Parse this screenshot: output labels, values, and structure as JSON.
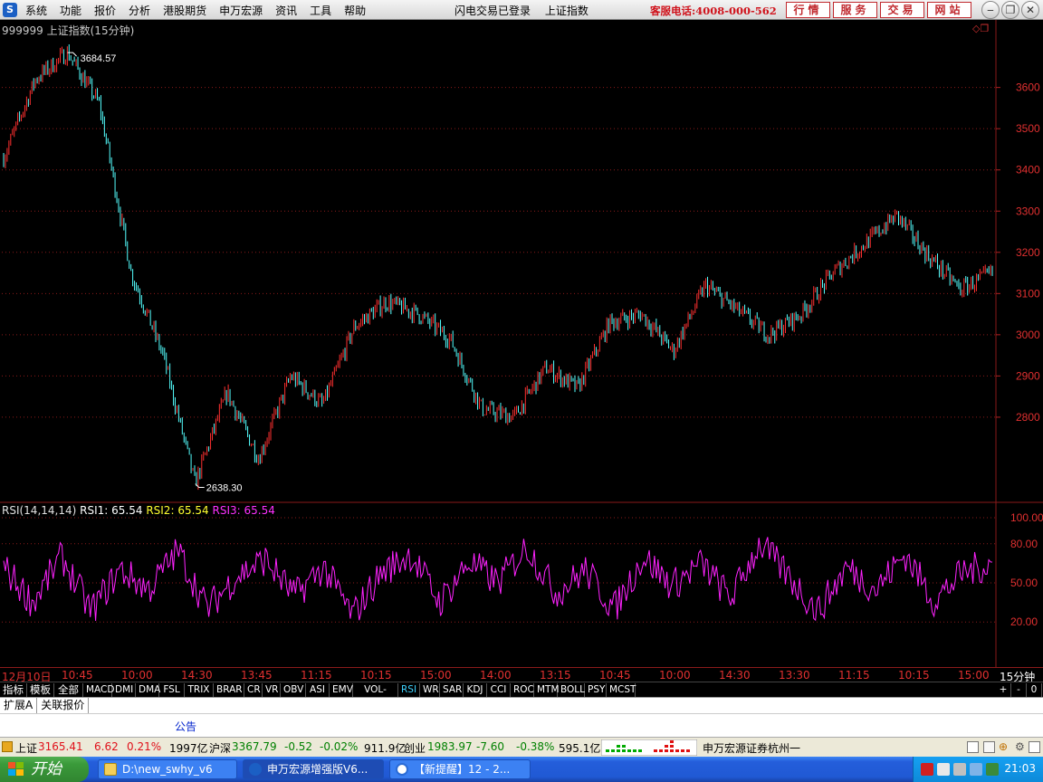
{
  "menubar": {
    "logo": "S",
    "items": [
      "系统",
      "功能",
      "报价",
      "分析",
      "港股期货",
      "申万宏源",
      "资讯",
      "工具",
      "帮助"
    ],
    "status_login": "闪电交易已登录",
    "current_index": "上证指数",
    "hotline": "客服电话:4008-000-562",
    "red_buttons": [
      "行情",
      "服务",
      "交易",
      "网站"
    ],
    "window_buttons": [
      "minimize-icon",
      "restore-icon",
      "close-icon"
    ]
  },
  "chart_header": {
    "code_name": "999999 上证指数(15分钟)",
    "high_label": "3684.57",
    "low_label": "2638.30"
  },
  "indicator_header": {
    "name": "RSI(14,14,14)",
    "rsi1_label": "RSI1:",
    "rsi1_value": "65.54",
    "rsi2_label": "RSI2:",
    "rsi2_value": "65.54",
    "rsi3_label": "RSI3:",
    "rsi3_value": "65.54"
  },
  "price_axis_labels": [
    "3600",
    "3500",
    "3400",
    "3300",
    "3200",
    "3100",
    "3000",
    "2900",
    "2800"
  ],
  "rsi_axis_labels": [
    "100.00",
    "80.00",
    "50.00",
    "20.00"
  ],
  "time_axis_labels": [
    "12月10日",
    "10:45",
    "10:00",
    "14:30",
    "13:45",
    "11:15",
    "10:15",
    "15:00",
    "14:00",
    "13:15",
    "10:45",
    "10:00",
    "14:30",
    "13:30",
    "11:15",
    "10:15",
    "15:00"
  ],
  "period_label": "15分钟",
  "tabbar": {
    "tabs": [
      "指标",
      "模板",
      "全部",
      "MACD",
      "DMI",
      "DMA",
      "FSL",
      "TRIX",
      "BRAR",
      "CR",
      "VR",
      "OBV",
      "ASI",
      "EMV",
      "VOL-TDX",
      "RSI",
      "WR",
      "SAR",
      "KDJ",
      "CCI",
      "ROC",
      "MTM",
      "BOLL",
      "PSY",
      "MCST"
    ],
    "active": "RSI",
    "right_controls": [
      "+",
      "-",
      "0"
    ]
  },
  "subtabs": [
    "扩展A",
    "关联报价"
  ],
  "notice_label": "公告",
  "statusbar": {
    "sh_label": "上证",
    "sh_value": "3165.41",
    "sh_change": "6.62",
    "sh_pct": "0.21%",
    "sh_amount": "1997亿",
    "hs_label": "沪深",
    "hs_value": "3367.79",
    "hs_change": "-0.52",
    "hs_pct": "-0.02%",
    "hs_amount": "911.9亿",
    "cy_label": "创业",
    "cy_value": "1983.97",
    "cy_change": "-7.60",
    "cy_pct": "-0.38%",
    "cy_amount": "595.1亿",
    "broker": "申万宏源证券杭州一"
  },
  "taskbar": {
    "start": "开始",
    "tasks": [
      "D:\\new_swhy_v6",
      "申万宏源增强版V6...",
      "【新提醒】12 - 2..."
    ],
    "clock": "21:03"
  },
  "chart_data": [
    {
      "type": "line",
      "title": "999999 上证指数(15分钟)",
      "ylim": [
        2600,
        3720
      ],
      "y_ticks": [
        3600,
        3500,
        3400,
        3300,
        3200,
        3100,
        3000,
        2900,
        2800
      ],
      "x": [
        "12月10日",
        "10:45",
        "10:00",
        "14:30",
        "13:45",
        "11:15",
        "10:15",
        "15:00",
        "14:00",
        "13:15",
        "10:45",
        "10:00",
        "14:30",
        "13:30",
        "11:15",
        "10:15",
        "15:00"
      ],
      "series": [
        {
          "values": [
            3430,
            3620,
            3684.57,
            3560,
            3150,
            2950,
            2638.3,
            2860,
            2700,
            2900,
            2830,
            3020,
            3080,
            3050,
            2990,
            2820,
            2800,
            2920,
            2870,
            3030,
            3050,
            2960,
            3120,
            3060,
            3000,
            3050,
            3150,
            3220,
            3290,
            3190,
            3110,
            3150
          ]
        }
      ],
      "annotations": [
        "3684.57",
        "2638.30"
      ],
      "colors": {
        "up": "#ff3030",
        "down": "#54ffff",
        "background": "#000000",
        "grid": "#8a1a1a"
      }
    },
    {
      "type": "line",
      "title": "RSI(14,14,14)",
      "ylim": [
        0,
        100
      ],
      "y_ticks": [
        100,
        80,
        50,
        20
      ],
      "series": [
        {
          "name": "RSI3",
          "values": [
            62,
            35,
            70,
            28,
            60,
            45,
            75,
            30,
            55,
            68,
            40,
            62,
            25,
            58,
            72,
            35,
            66,
            50,
            78,
            42,
            60,
            30,
            70,
            48,
            65,
            38,
            80,
            55,
            28,
            62,
            45,
            72,
            36,
            58,
            65
          ]
        }
      ],
      "colors": {
        "RSI3": "#ff22ff"
      }
    }
  ]
}
